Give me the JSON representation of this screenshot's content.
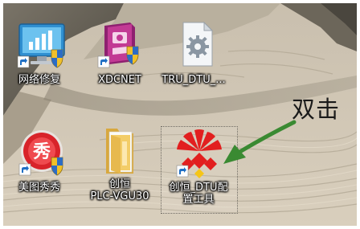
{
  "desktop": {
    "icons": [
      {
        "name": "network-repair",
        "label_lines": [
          "网络修复"
        ],
        "icon": "network-monitor-icon"
      },
      {
        "name": "xdcnet",
        "label_lines": [
          "XDCNET"
        ],
        "icon": "xdcnet-app-icon"
      },
      {
        "name": "tru-dtu",
        "label_lines": [
          "TRU_DTU_..."
        ],
        "icon": "gear-document-icon"
      },
      {
        "name": "meitu-xiuxiu",
        "label_lines": [
          "美图秀秀"
        ],
        "icon": "meitu-icon"
      },
      {
        "name": "chuangheng-plc-vgu30",
        "label_lines": [
          "创恒",
          "PLC-VGU30"
        ],
        "icon": "folder-icon"
      },
      {
        "name": "chuangheng-dtu-config",
        "label_lines": [
          "创恒_DTU配",
          "置工具"
        ],
        "icon": "chuangheng-logo-icon"
      }
    ]
  },
  "annotation": {
    "text": "双击",
    "arrow_color": "#3a8a32"
  },
  "colors": {
    "network_icon_bg": "#3aa0d8",
    "xdcnet_icon_bg": "#b0308a",
    "meitu_red": "#d8232a",
    "chuangheng_red": "#e21f1f",
    "folder_yellow": "#f3cd68",
    "shortcut_arrow_blue": "#1f6fc4"
  }
}
